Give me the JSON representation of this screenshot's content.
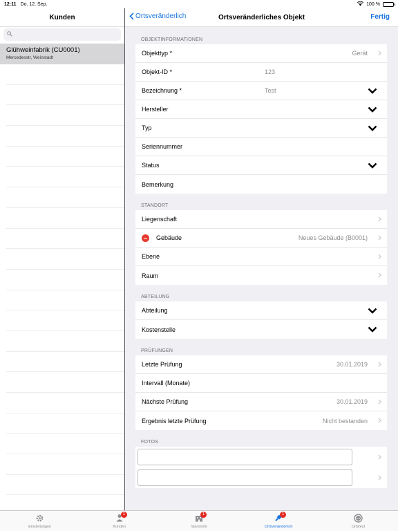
{
  "status": {
    "time": "12:11",
    "date": "Do. 12. Sep.",
    "battery": "100 %"
  },
  "left": {
    "title": "Kunden",
    "search_placeholder": "",
    "customers": [
      {
        "name": "Glühweinfabrik (CU0001)",
        "address": "Mercedesstr, Weinstadt"
      }
    ]
  },
  "nav": {
    "back": "Ortsveränderlich",
    "title": "Ortsveränderliches Objekt",
    "done": "Fertig"
  },
  "sections": {
    "objekt": {
      "header": "OBJEKTINFORMATIONEN",
      "rows": [
        {
          "label": "Objekttyp *",
          "value": "Gerät"
        },
        {
          "label": "Objekt-ID *",
          "value": "123"
        },
        {
          "label": "Bezeichnung *",
          "value": "Test"
        },
        {
          "label": "Hersteller",
          "value": ""
        },
        {
          "label": "Typ",
          "value": ""
        },
        {
          "label": "Seriennummer",
          "value": ""
        },
        {
          "label": "Status",
          "value": ""
        },
        {
          "label": "Bemerkung",
          "value": ""
        }
      ]
    },
    "standort": {
      "header": "STANDORT",
      "rows": [
        {
          "label": "Liegenschaft",
          "value": ""
        },
        {
          "label": "Gebäude",
          "value": "Neues Gebäude (B0001)"
        },
        {
          "label": "Ebene",
          "value": ""
        },
        {
          "label": "Raum",
          "value": ""
        }
      ]
    },
    "abteilung": {
      "header": "ABTEILUNG",
      "rows": [
        {
          "label": "Abteilung",
          "value": ""
        },
        {
          "label": "Kostenstelle",
          "value": ""
        }
      ]
    },
    "pruefungen": {
      "header": "PRÜFUNGEN",
      "rows": [
        {
          "label": "Letzte Prüfung",
          "value": "30.01.2019"
        },
        {
          "label": "Intervall (Monate)",
          "value": ""
        },
        {
          "label": "Nächste Prüfung",
          "value": "30.01.2019"
        },
        {
          "label": "Ergebnis letzte Prüfung",
          "value": "Nicht bestanden"
        }
      ]
    },
    "fotos": {
      "header": "FOTOS"
    }
  },
  "tabs": [
    {
      "label": "Einstellungen",
      "icon": "gear-icon",
      "badge": ""
    },
    {
      "label": "Kunden",
      "icon": "person-icon",
      "badge": "1"
    },
    {
      "label": "Standorte",
      "icon": "building-icon",
      "badge": "1"
    },
    {
      "label": "Ortsveränderlich",
      "icon": "plug-icon",
      "badge": "1"
    },
    {
      "label": "Ortsfest",
      "icon": "socket-icon",
      "badge": ""
    }
  ],
  "colors": {
    "accent": "#1a74e0",
    "badge": "#e5281f",
    "delete": "#e83a30"
  }
}
